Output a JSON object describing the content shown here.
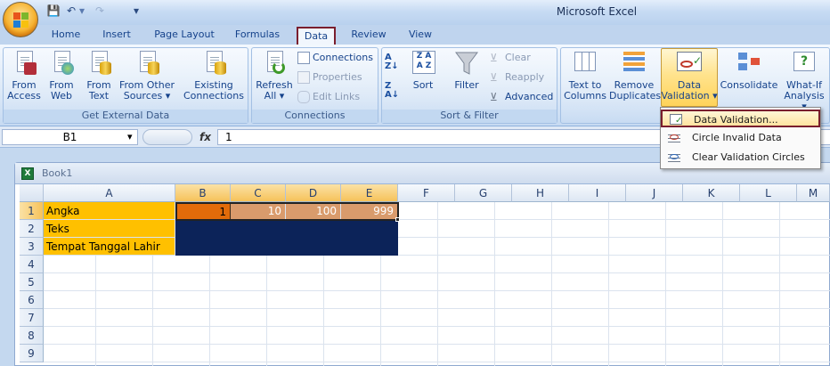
{
  "app": {
    "title": "Microsoft Excel"
  },
  "quick_access": {
    "save": "💾",
    "undo": "↶",
    "redo": "↷",
    "customize": "▾"
  },
  "tabs": [
    "Home",
    "Insert",
    "Page Layout",
    "Formulas",
    "Data",
    "Review",
    "View"
  ],
  "active_tab": "Data",
  "ribbon": {
    "get_external_data": {
      "label": "Get External Data",
      "buttons": [
        {
          "line1": "From",
          "line2": "Access"
        },
        {
          "line1": "From",
          "line2": "Web"
        },
        {
          "line1": "From",
          "line2": "Text"
        },
        {
          "line1": "From Other",
          "line2": "Sources ▾"
        },
        {
          "line1": "Existing",
          "line2": "Connections"
        }
      ]
    },
    "connections": {
      "label": "Connections",
      "refresh": {
        "line1": "Refresh",
        "line2": "All ▾"
      },
      "connections": "Connections",
      "properties": "Properties",
      "edit_links": "Edit Links"
    },
    "sort_filter": {
      "label": "Sort & Filter",
      "sort": "Sort",
      "filter": "Filter",
      "clear": "Clear",
      "reapply": "Reapply",
      "advanced": "Advanced"
    },
    "data_tools": {
      "text_to_columns": {
        "line1": "Text to",
        "line2": "Columns"
      },
      "remove_duplicates": {
        "line1": "Remove",
        "line2": "Duplicates"
      },
      "data_validation": {
        "line1": "Data",
        "line2": "Validation ▾"
      },
      "consolidate": "Consolidate",
      "what_if": {
        "line1": "What-If",
        "line2": "Analysis ▾"
      }
    }
  },
  "dropdown": {
    "items": [
      "Data Validation...",
      "Circle Invalid Data",
      "Clear Validation Circles"
    ]
  },
  "formula_bar": {
    "name_box": "B1",
    "name_arrow": "▾",
    "fx": "fx",
    "value": "1"
  },
  "workbook": {
    "title": "Book1"
  },
  "sheet": {
    "columns": [
      "A",
      "B",
      "C",
      "D",
      "E",
      "F",
      "G",
      "H",
      "I",
      "J",
      "K",
      "L",
      "M"
    ],
    "rows": [
      "1",
      "2",
      "3",
      "4",
      "5",
      "6",
      "7",
      "8",
      "9"
    ],
    "cells": {
      "A1": "Angka",
      "A2": "Teks",
      "A3": "Tempat Tanggal Lahir",
      "B1": "1",
      "C1": "10",
      "D1": "100",
      "E1": "999"
    }
  },
  "colors": {
    "accent_selection": "#7a1e2e",
    "label_fill": "#ffc000",
    "selected_orange": "#e26b0a",
    "range_fill": "#d99b6c",
    "dark_fill": "#0c2359"
  }
}
